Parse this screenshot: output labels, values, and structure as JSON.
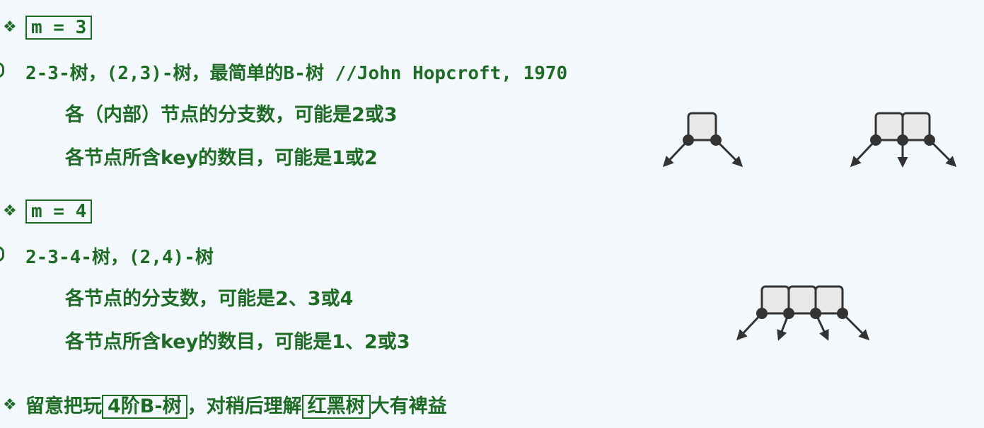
{
  "colors": {
    "text": "#1e6b25",
    "node_fill": "#e8e8e8",
    "node_stroke": "#333333",
    "background": "#f3f8fc"
  },
  "icons": {
    "bullet": "diamond-bullet-icon"
  },
  "section1": {
    "m_label": "m = 3",
    "heading": "2-3-树，(2,3)-树，最简单的B-树 //John Hopcroft, 1970",
    "line1": "各（内部）节点的分支数，可能是2或3",
    "line2": "各节点所含key的数目，可能是1或2"
  },
  "section2": {
    "m_label": "m = 4",
    "heading": "2-3-4-树，(2,4)-树",
    "line1": "各节点的分支数，可能是2、3或4",
    "line2": "各节点所含key的数目，可能是1、2或3"
  },
  "footer": {
    "part1": "留意把玩",
    "boxed1": "4阶B-树",
    "part2": "，对稍后理解",
    "boxed2": "红黑树",
    "part3": "大有裨益"
  }
}
